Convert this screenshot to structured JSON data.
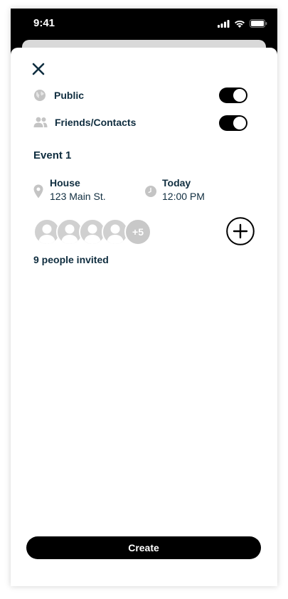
{
  "status_bar": {
    "time": "9:41"
  },
  "visibility": {
    "public": {
      "label": "Public",
      "enabled": true
    },
    "friends": {
      "label": "Friends/Contacts",
      "enabled": true
    }
  },
  "event": {
    "title": "Event 1",
    "location": {
      "title": "House",
      "address": "123 Main St."
    },
    "time": {
      "day": "Today",
      "time": "12:00 PM"
    }
  },
  "invitees": {
    "more_badge": "+5",
    "summary": "9 people invited"
  },
  "actions": {
    "create_label": "Create"
  },
  "colors": {
    "text": "#0f2d3f",
    "accent": "#000000",
    "icon_gray": "#c4c4c4"
  }
}
